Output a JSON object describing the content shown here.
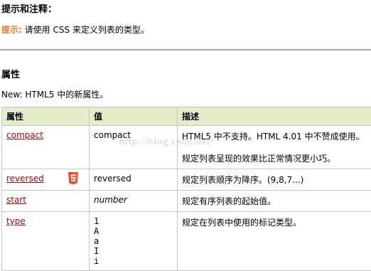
{
  "tips": {
    "heading": "提示和注释：",
    "label": "提示:",
    "text": " 请使用  CSS 来定义列表的类型。"
  },
  "attributes": {
    "heading": "属性",
    "new_label": "New: ",
    "new_text": "HTML5 中的新属性。"
  },
  "watermark": "http://blog.csdn.net/",
  "table": {
    "headers": [
      "属性",
      "值",
      "描述"
    ],
    "rows": [
      {
        "attr": "compact",
        "value": "compact",
        "desc": [
          "HTML5 中不支持。HTML 4.01 中不赞成使用。",
          "规定列表呈现的效果比正常情况更小巧。"
        ]
      },
      {
        "attr": "reversed",
        "html5": true,
        "value": "reversed",
        "desc": [
          "规定列表顺序为降序。(9,8,7...)"
        ]
      },
      {
        "attr": "start",
        "value": "number",
        "desc": [
          "规定有序列表的起始值。"
        ]
      },
      {
        "attr": "type",
        "value_list": [
          "1",
          "A",
          "a",
          "I",
          "i"
        ],
        "desc": [
          "规定在列表中使用的标记类型。"
        ]
      }
    ]
  },
  "colors": {
    "tip_label": "#e27a2f",
    "link": "#900b09",
    "header_bg": "#e5eecc",
    "html5_badge": "#e44d26"
  }
}
